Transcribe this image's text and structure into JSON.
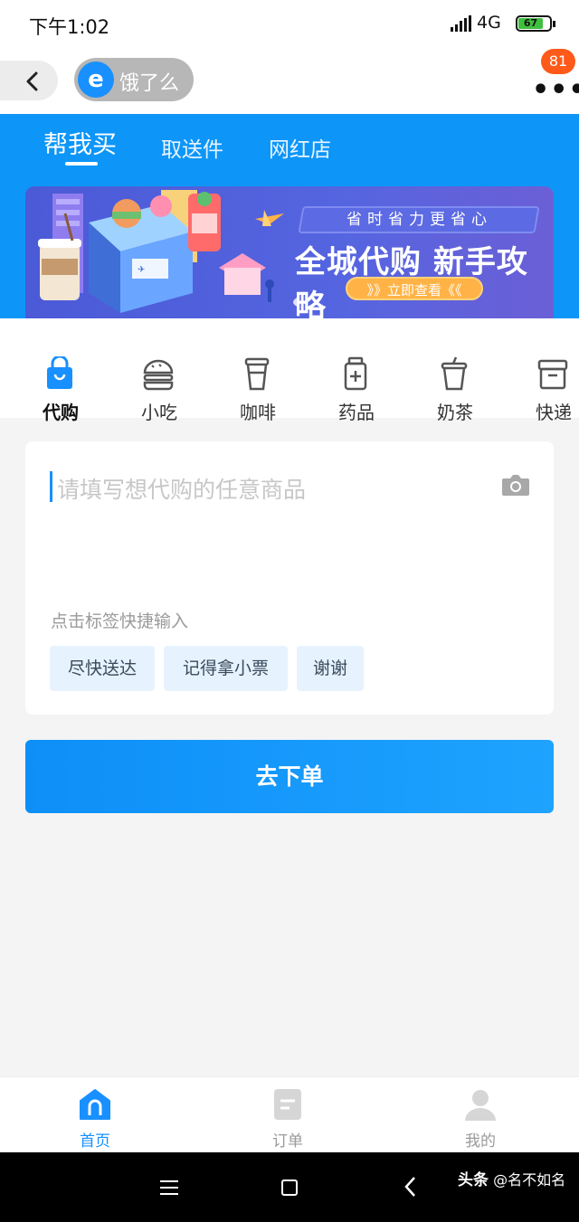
{
  "status_bar": {
    "time": "下午1:02",
    "network": "4G",
    "battery": "67"
  },
  "nav": {
    "brand_logo_letter": "e",
    "brand_name": "饿了么",
    "more_icon": "more-dots-icon",
    "badge_count": "81"
  },
  "tabs": [
    {
      "label": "帮我买",
      "active": true
    },
    {
      "label": "取送件",
      "active": false
    },
    {
      "label": "网红店",
      "active": false
    }
  ],
  "banner": {
    "subtitle": "省时省力更省心",
    "title": "全城代购 新手攻略",
    "cta": "》》立即查看《《"
  },
  "categories": [
    {
      "label": "代购",
      "icon": "shopping-bag-icon",
      "active": true
    },
    {
      "label": "小吃",
      "icon": "burger-icon",
      "active": false
    },
    {
      "label": "咖啡",
      "icon": "coffee-cup-icon",
      "active": false
    },
    {
      "label": "药品",
      "icon": "medicine-bottle-icon",
      "active": false
    },
    {
      "label": "奶茶",
      "icon": "milk-tea-icon",
      "active": false
    },
    {
      "label": "快递",
      "icon": "parcel-box-icon",
      "active": false
    }
  ],
  "input": {
    "placeholder": "请填写想代购的任意商品",
    "value": "",
    "camera_icon": "camera-icon"
  },
  "tags": {
    "hint": "点击标签快捷输入",
    "items": [
      "尽快送达",
      "记得拿小票",
      "谢谢"
    ]
  },
  "order_button": "去下单",
  "bottom_tabs": [
    {
      "label": "首页",
      "icon": "home-icon",
      "active": true
    },
    {
      "label": "订单",
      "icon": "order-icon",
      "active": false
    },
    {
      "label": "我的",
      "icon": "profile-icon",
      "active": false
    }
  ],
  "watermark": {
    "source": "头条",
    "author": "@名不如名"
  },
  "colors": {
    "primary": "#0d96f8",
    "badge": "#ff5a19",
    "tag_bg": "#e6f3ff"
  }
}
